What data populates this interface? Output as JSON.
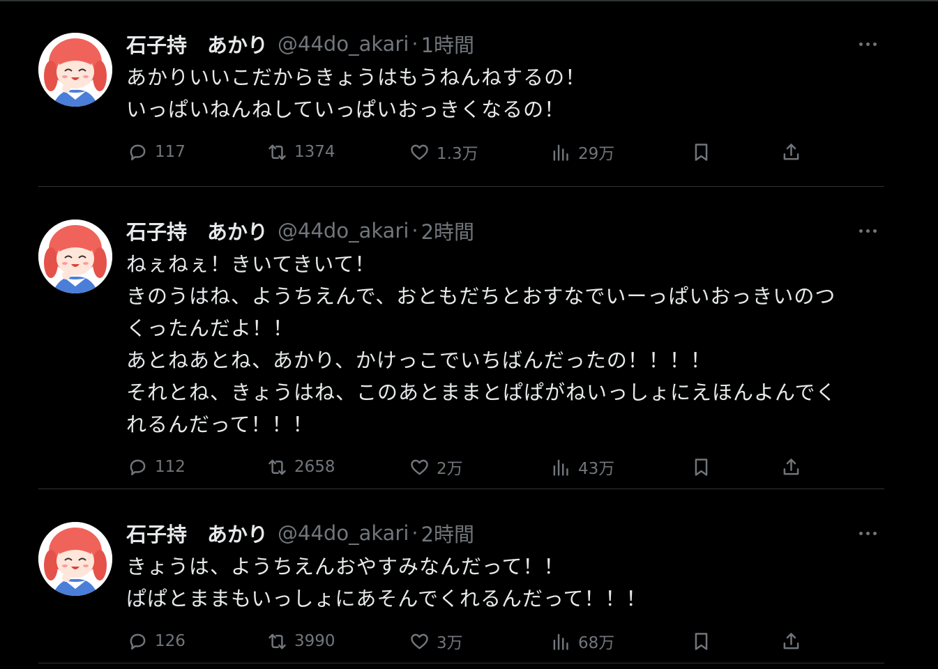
{
  "tweets": [
    {
      "name": "石子持　あかり",
      "handle": "@44do_akari",
      "separator": "·",
      "time": "1時間",
      "lines": [
        "あかりいいこだからきょうはもうねんねするの！",
        "いっぱいねんねしていっぱいおっきくなるの！"
      ],
      "replies": "117",
      "retweets": "1374",
      "likes": "1.3万",
      "views": "29万"
    },
    {
      "name": "石子持　あかり",
      "handle": "@44do_akari",
      "separator": "·",
      "time": "2時間",
      "lines": [
        "ねぇねぇ！きいてきいて！",
        "きのうはね、ようちえんで、おともだちとおすなでいーっぱいおっきいのつ",
        "くったんだよ！！",
        "あとねあとね、あかり、かけっこでいちばんだったの！！！！",
        "それとね、きょうはね、このあとままとぱぱがねいっしょにえほんよんでく",
        "れるんだって！！！"
      ],
      "replies": "112",
      "retweets": "2658",
      "likes": "2万",
      "views": "43万"
    },
    {
      "name": "石子持　あかり",
      "handle": "@44do_akari",
      "separator": "·",
      "time": "2時間",
      "lines": [
        "きょうは、ようちえんおやすみなんだって！！",
        "ぱぱとままもいっしょにあそんでくれるんだって！！！"
      ],
      "replies": "126",
      "retweets": "3990",
      "likes": "3万",
      "views": "68万"
    }
  ],
  "icons": {
    "reply": "speech-bubble-icon",
    "retweet": "retweet-arrows-icon",
    "like": "heart-icon",
    "views": "bar-chart-icon",
    "bookmark": "bookmark-icon",
    "share": "share-upload-icon",
    "more": "more-dots-icon"
  },
  "colors": {
    "background": "#000000",
    "text": "#e7e9ea",
    "muted": "#71767b",
    "divider": "#2f3336",
    "avatar_hair": "#f0635a"
  }
}
